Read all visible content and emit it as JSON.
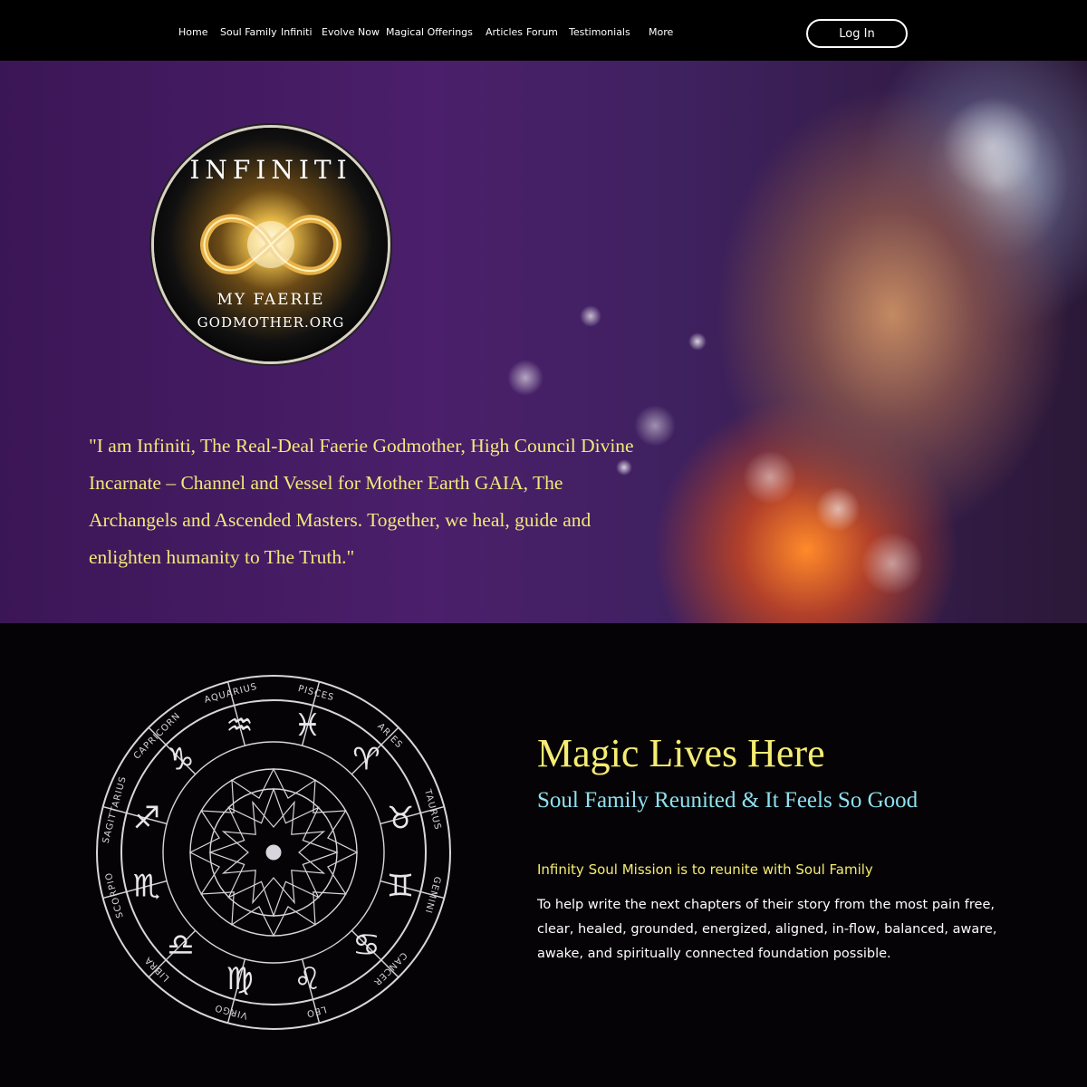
{
  "nav": {
    "items": [
      "Home",
      "Soul Family",
      "Infiniti",
      "Evolve Now",
      "Magical Offerings",
      "Articles",
      "Forum",
      "Testimonials",
      "More"
    ],
    "login_label": "Log In"
  },
  "hero": {
    "logo": {
      "top": "INFINITI",
      "bottom1": "MY FAERIE",
      "bottom2": "GODMOTHER.ORG"
    },
    "quote": "\"I am Infiniti, The Real-Deal Faerie Godmother, High Council Divine Incarnate – Channel and Vessel for Mother Earth GAIA, The Archangels and Ascended Masters. Together, we heal, guide and enlighten humanity to The Truth.\""
  },
  "zodiac": {
    "signs": [
      "PISCES",
      "ARIES",
      "TAURUS",
      "GEMINI",
      "CANCER",
      "LEO",
      "VIRGO",
      "LIBRA",
      "SCORPIO",
      "SAGITTARIUS",
      "CAPRICORN",
      "AQUARIUS"
    ],
    "glyphs": [
      "♓",
      "♈",
      "♉",
      "♊",
      "♋",
      "♌",
      "♍",
      "♎",
      "♏",
      "♐",
      "♑",
      "♒"
    ]
  },
  "section": {
    "title": "Magic Lives Here",
    "subtitle": "Soul Family Reunited & It Feels So Good",
    "mission_heading": "Infinity Soul Mission is to reunite with Soul Family",
    "mission_text": "To help write the next chapters of their story from the most pain free, clear, healed, grounded, energized, aligned, in-flow, balanced, aware, awake, and spiritually connected foundation possible."
  },
  "colors": {
    "gold": "#f5ec74",
    "cyan": "#8ee0ef",
    "purple": "#4b1f6b"
  }
}
